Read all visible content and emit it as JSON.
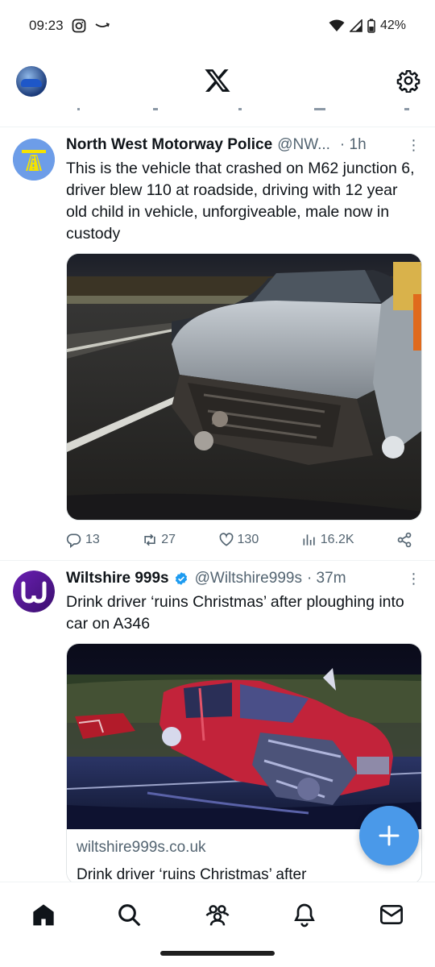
{
  "status_bar": {
    "time": "09:23",
    "battery": "42%"
  },
  "app_bar": {
    "logo": "x-logo-icon",
    "settings": "gear-icon"
  },
  "tweets": [
    {
      "name": "North West Motorway Police",
      "handle": "@NW...",
      "time": "· 1h",
      "verified": false,
      "text": "This is the vehicle that crashed on M62 junction 6, driver blew 110 at roadside, driving with 12 year old child in vehicle, unforgiveable, male now in custody",
      "media": "crashed-silver-car-photo",
      "actions": {
        "replies": "13",
        "reposts": "27",
        "likes": "130",
        "views": "16.2K"
      }
    },
    {
      "name": "Wiltshire 999s",
      "handle": "@Wiltshire999s",
      "time": "· 37m",
      "verified": true,
      "text": "Drink driver ‘ruins Christmas’ after ploughing into car on A346",
      "media": "crashed-red-car-photo",
      "link_card": {
        "domain": "wiltshire999s.co.uk",
        "title": "Drink driver ‘ruins Christmas’ after"
      }
    }
  ],
  "colors": {
    "accent": "#1d9bf0",
    "fab": "#4a99e9",
    "muted": "#536471"
  },
  "bottom_nav": [
    "home-icon",
    "search-icon",
    "communities-icon",
    "notifications-icon",
    "messages-icon"
  ]
}
